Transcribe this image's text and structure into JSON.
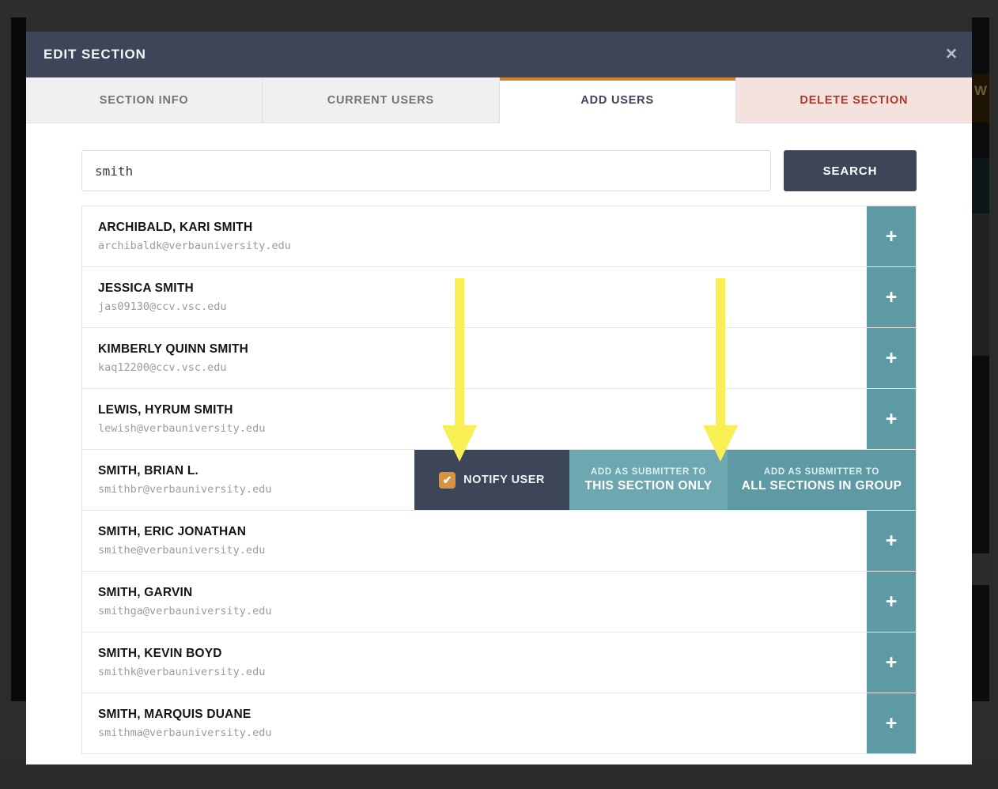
{
  "modal": {
    "title": "EDIT SECTION",
    "close_icon": "close-icon",
    "close_glyph": "✕"
  },
  "tabs": [
    {
      "label": "SECTION INFO",
      "state": "inactive"
    },
    {
      "label": "CURRENT USERS",
      "state": "inactive"
    },
    {
      "label": "ADD USERS",
      "state": "active"
    },
    {
      "label": "DELETE SECTION",
      "state": "danger"
    }
  ],
  "search": {
    "value": "smith",
    "placeholder": "",
    "button_label": "SEARCH"
  },
  "results": {
    "add_glyph": "+",
    "rows": [
      {
        "name": "ARCHIBALD, KARI SMITH",
        "email": "archibaldk@verbauniversity.edu",
        "expanded": false
      },
      {
        "name": "JESSICA SMITH",
        "email": "jas09130@ccv.vsc.edu",
        "expanded": false
      },
      {
        "name": "KIMBERLY QUINN SMITH",
        "email": "kaq12200@ccv.vsc.edu",
        "expanded": false
      },
      {
        "name": "LEWIS, HYRUM SMITH",
        "email": "lewish@verbauniversity.edu",
        "expanded": false
      },
      {
        "name": "SMITH, BRIAN L.",
        "email": "smithbr@verbauniversity.edu",
        "expanded": true
      },
      {
        "name": "SMITH, ERIC JONATHAN",
        "email": "smithe@verbauniversity.edu",
        "expanded": false
      },
      {
        "name": "SMITH, GARVIN",
        "email": "smithga@verbauniversity.edu",
        "expanded": false
      },
      {
        "name": "SMITH, KEVIN BOYD",
        "email": "smithk@verbauniversity.edu",
        "expanded": false
      },
      {
        "name": "SMITH, MARQUIS DUANE",
        "email": "smithma@verbauniversity.edu",
        "expanded": false
      }
    ]
  },
  "expanded_actions": {
    "notify_label": "NOTIFY USER",
    "notify_checked": true,
    "check_glyph": "✔",
    "this_section": {
      "top_label": "ADD AS SUBMITTER TO",
      "bottom_label": "THIS SECTION ONLY"
    },
    "all_sections": {
      "top_label": "ADD AS SUBMITTER TO",
      "bottom_label": "ALL SECTIONS IN GROUP"
    }
  },
  "annotations": {
    "arrow_color": "#f7ef54",
    "arrows": [
      {
        "name": "annotation-arrow-this-section"
      },
      {
        "name": "annotation-arrow-all-sections"
      }
    ]
  },
  "background": {
    "partial_text": "W"
  },
  "colors": {
    "header_navy": "#3c4658",
    "accent_orange": "#cd8433",
    "teal_light": "#6da8b0",
    "teal_dark": "#5d9aa3",
    "danger_red": "#b0392c",
    "danger_bg": "#f4e2df",
    "checkbox_orange": "#d79340"
  }
}
